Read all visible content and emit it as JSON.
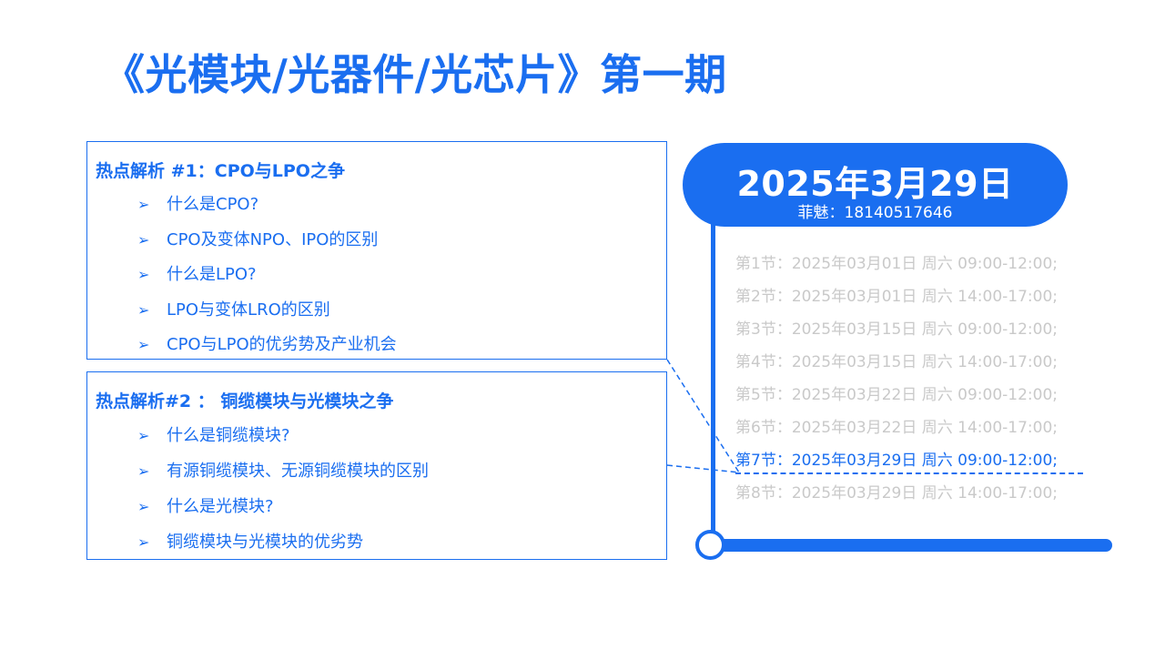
{
  "title": "《光模块/光器件/光芯片》第一期",
  "topics": [
    {
      "heading": "热点解析 #1：CPO与LPO之争",
      "items": [
        "什么是CPO?",
        "CPO及变体NPO、IPO的区别",
        "什么是LPO?",
        "LPO与变体LRO的区别",
        "CPO与LPO的优劣势及产业机会"
      ]
    },
    {
      "heading": "热点解析#2 ： 铜缆模块与光模块之争",
      "items": [
        "什么是铜缆模块?",
        "有源铜缆模块、无源铜缆模块的区别",
        "什么是光模块?",
        "铜缆模块与光模块的优劣势"
      ]
    }
  ],
  "bullet_glyph": "➢",
  "date_badge": {
    "date": "2025年3月29日",
    "contact": "菲魅：18140517646"
  },
  "sessions": [
    "第1节：2025年03月01日 周六 09:00-12:00;",
    "第2节：2025年03月01日 周六 14:00-17:00;",
    "第3节：2025年03月15日 周六 09:00-12:00;",
    "第4节：2025年03月15日 周六 14:00-17:00;",
    "第5节：2025年03月22日 周六 09:00-12:00;",
    "第6节：2025年03月22日 周六 14:00-17:00;",
    "第7节：2025年03月29日 周六 09:00-12:00;",
    "第8节：2025年03月29日 周六 14:00-17:00;"
  ],
  "active_session": 7,
  "colors": {
    "accent": "#1a6ef0",
    "inactive_text": "#c9c9c9"
  }
}
